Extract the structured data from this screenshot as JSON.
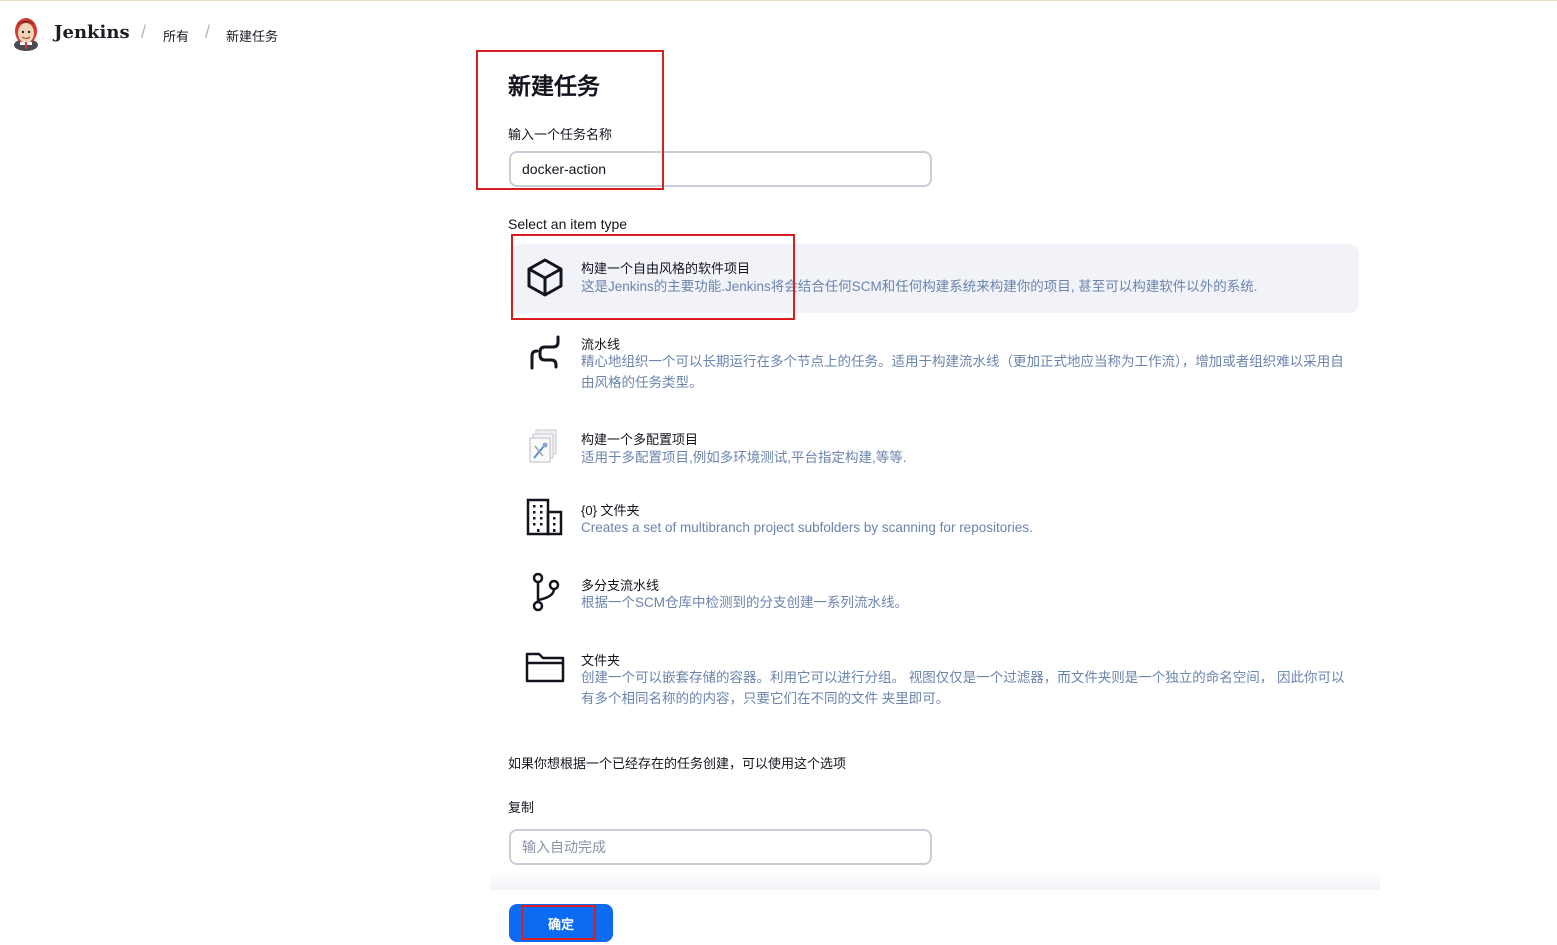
{
  "header": {
    "brand": "Jenkins",
    "breadcrumbs": [
      {
        "label": "所有"
      },
      {
        "label": "新建任务"
      }
    ]
  },
  "main": {
    "title": "新建任务",
    "name_label": "输入一个任务名称",
    "name_value": "docker-action",
    "section_label": "Select an item type",
    "items": [
      {
        "title": "构建一个自由风格的软件项目",
        "desc": "这是Jenkins的主要功能.Jenkins将会结合任何SCM和任何构建系统来构建你的项目, 甚至可以构建软件以外的系统.",
        "icon": "cube-icon",
        "selected": true
      },
      {
        "title": "流水线",
        "desc": "精心地组织一个可以长期运行在多个节点上的任务。适用于构建流水线（更加正式地应当称为工作流），增加或者组织难以采用自由风格的任务类型。",
        "icon": "pipeline-icon"
      },
      {
        "title": "构建一个多配置项目",
        "desc": "适用于多配置项目,例如多环境测试,平台指定构建,等等.",
        "icon": "multi-config-icon"
      },
      {
        "title": "{0} 文件夹",
        "desc": "Creates a set of multibranch project subfolders by scanning for repositories.",
        "icon": "building-icon"
      },
      {
        "title": "多分支流水线",
        "desc": "根据一个SCM仓库中检测到的分支创建一系列流水线。",
        "icon": "branch-icon"
      },
      {
        "title": "文件夹",
        "desc": "创建一个可以嵌套存储的容器。利用它可以进行分组。 视图仅仅是一个过滤器，而文件夹则是一个独立的命名空间， 因此你可以有多个相同名称的的内容，只要它们在不同的文件 夹里即可。",
        "icon": "folder-icon"
      }
    ],
    "copy_hint": "如果你想根据一个已经存在的任务创建，可以使用这个选项",
    "copy_label": "复制",
    "copy_placeholder": "输入自动完成",
    "ok_label": "确定"
  },
  "colors": {
    "accent": "#0b6bf2",
    "description": "#6b84ad",
    "selected_bg": "#f1f3f8",
    "annotation": "#d81e1e"
  }
}
